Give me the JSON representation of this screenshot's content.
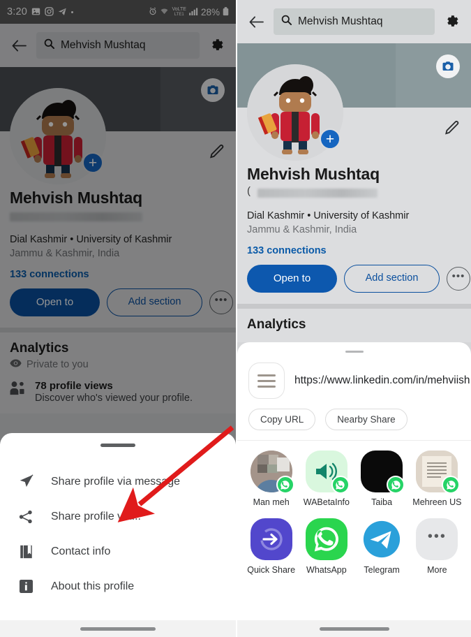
{
  "statusbar": {
    "time": "3:20",
    "left_icons": [
      "gallery-icon",
      "instagram-icon",
      "telegram-icon",
      "dot-icon"
    ],
    "alarm": "alarm-icon",
    "wifi": "wifi-icon",
    "volte": "VoLTE",
    "signal": "signal-icon",
    "battery_percent": "28%",
    "battery": "battery-icon"
  },
  "header": {
    "back": "back-arrow-icon",
    "search_value": "Mehvish Mushtaq",
    "search_icon": "search-icon",
    "settings_icon": "gear-icon"
  },
  "profile": {
    "camera_button": "camera-icon",
    "edit_button": "pencil-icon",
    "add_photo_badge": "plus-icon",
    "name": "Mehvish Mushtaq",
    "pronouns_prefix": "(",
    "headline": "Dial Kashmir • University of Kashmir",
    "location": "Jammu & Kashmir, India",
    "connections": "133 connections",
    "buttons": {
      "primary": "Open to",
      "secondary": "Add section",
      "more": "•••"
    }
  },
  "analytics": {
    "title": "Analytics",
    "visibility": "Private to you",
    "visibility_icon": "eye-icon",
    "item_icon": "people-icon",
    "item_title": "78 profile views",
    "item_subtitle": "Discover who's viewed your profile."
  },
  "left_sheet": {
    "grabber": "drag-handle",
    "items": [
      {
        "icon": "send-icon",
        "label": "Share profile via message"
      },
      {
        "icon": "share-icon",
        "label": "Share profile via..."
      },
      {
        "icon": "contact-card-icon",
        "label": "Contact info"
      },
      {
        "icon": "info-icon",
        "label": "About this profile"
      }
    ]
  },
  "right_sheet": {
    "grabber": "drag-handle",
    "link_icon": "link-preview-icon",
    "url": "https://www.linkedin.com/in/mehviish",
    "chips": [
      "Copy URL",
      "Nearby Share"
    ],
    "contacts_row": [
      {
        "label": "Man meh",
        "badge": "whatsapp-icon",
        "thumb": "photo-blurred"
      },
      {
        "label": "WABetaInfo",
        "badge": "whatsapp-icon",
        "thumb": "megaphone-icon"
      },
      {
        "label": "Taiba",
        "badge": "whatsapp-icon",
        "thumb": "black-photo"
      },
      {
        "label": "Mehreen US",
        "badge": "whatsapp-icon",
        "thumb": "document-photo"
      }
    ],
    "apps_row": [
      {
        "label": "Quick Share",
        "icon": "quick-share-icon"
      },
      {
        "label": "WhatsApp",
        "icon": "whatsapp-icon"
      },
      {
        "label": "Telegram",
        "icon": "telegram-icon"
      },
      {
        "label": "More",
        "icon": "more-dots-icon"
      }
    ]
  },
  "annotation": {
    "arrow_color": "#e01b1b",
    "points_to": "Share profile via..."
  },
  "colors": {
    "linkedin_blue": "#0a4f9e",
    "link_blue": "#0a5aa8",
    "whatsapp_green": "#25d366",
    "telegram_blue": "#2aa0da",
    "quickshare_purple": "#5247cc",
    "cover_right": "#839396",
    "cover_left_dim": "#4a4f53"
  }
}
